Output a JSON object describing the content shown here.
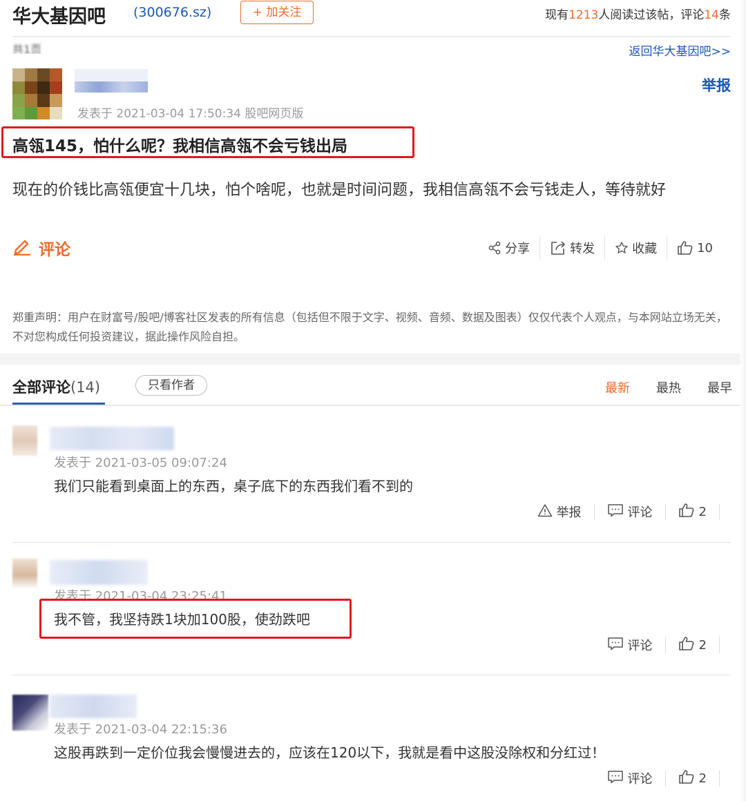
{
  "header": {
    "bar_title": "华大基因吧",
    "stock_code": "(300676.sz)",
    "follow_label": "+ 加关注",
    "stats_prefix": "现有",
    "read_count": "1213",
    "stats_mid": "人阅读过该帖，评论",
    "comment_count": "14",
    "stats_suffix": "条"
  },
  "nav": {
    "page_count": "共1页",
    "back_link": "返回华大基因吧>>"
  },
  "post": {
    "report_label": "举报",
    "meta": "发表于 2021-03-04 17:50:34 股吧网页版",
    "title": "高瓴145，怕什么呢？我相信高瓴不会亏钱出局",
    "body": "现在的价钱比高瓴便宜十几块，怕个啥呢，也就是时间问题，我相信高瓴不会亏钱走人，等待就好",
    "comment_label": "评论",
    "actions": {
      "share": "分享",
      "forward": "转发",
      "favorite": "收藏",
      "like_count": "10"
    },
    "disclaimer": "郑重声明：用户在财富号/股吧/博客社区发表的所有信息（包括但不限于文字、视频、音频、数据及图表）仅仅代表个人观点，与本网站立场无关，不对您构成任何投资建议，据此操作风险自担。"
  },
  "comments_header": {
    "all_label": "全部评论",
    "count": "(14)",
    "author_only": "只看作者",
    "sort_newest": "最新",
    "sort_hottest": "最热",
    "sort_earliest": "最早"
  },
  "comments": [
    {
      "meta": "发表于 2021-03-05 09:07:24",
      "text": "我们只能看到桌面上的东西，桌子底下的东西我们看不到的",
      "report_label": "举报",
      "comment_label": "评论",
      "likes": "2"
    },
    {
      "meta": "发表于 2021-03-04 23:25:41",
      "text": "我不管，我坚持跌1块加100股，使劲跌吧",
      "comment_label": "评论",
      "likes": "2"
    },
    {
      "meta": "发表于 2021-03-04 22:15:36",
      "text": "这股再跌到一定价位我会慢慢进去的，应该在120以下，我就是看中这股没除权和分红过！",
      "comment_label": "评论",
      "likes": "2"
    }
  ],
  "colors": {
    "accent_orange": "#f06a2b",
    "link_blue": "#1a57b6",
    "highlight_red": "#e3161e"
  },
  "icons": [
    "pencil-icon",
    "share-icon",
    "forward-icon",
    "star-icon",
    "thumbs-up-icon",
    "warning-icon",
    "comment-bubble-icon"
  ]
}
